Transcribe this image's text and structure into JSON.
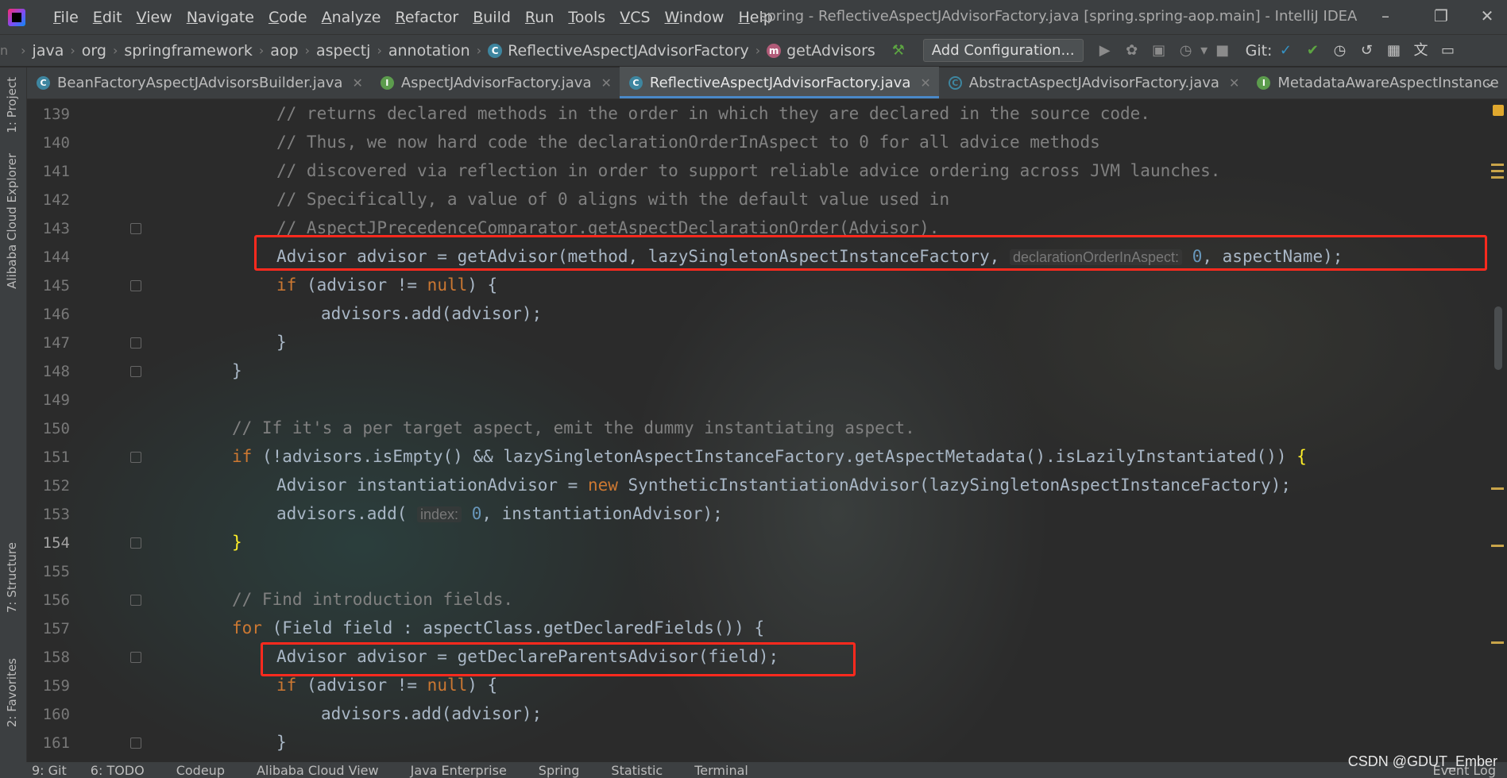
{
  "menu": [
    "File",
    "Edit",
    "View",
    "Navigate",
    "Code",
    "Analyze",
    "Refactor",
    "Build",
    "Run",
    "Tools",
    "VCS",
    "Window",
    "Help"
  ],
  "window_title": "spring - ReflectiveAspectJAdvisorFactory.java [spring.spring-aop.main] - IntelliJ IDEA",
  "breadcrumb": [
    "java",
    "org",
    "springframework",
    "aop",
    "aspectj",
    "annotation",
    "ReflectiveAspectJAdvisorFactory",
    "getAdvisors"
  ],
  "toolbar": {
    "add_configuration": "Add Configuration...",
    "git_label": "Git:"
  },
  "tabs": [
    {
      "label": "BeanFactoryAspectJAdvisorsBuilder.java",
      "icon": "class-icon"
    },
    {
      "label": "AspectJAdvisorFactory.java",
      "icon": "interface-icon"
    },
    {
      "label": "ReflectiveAspectJAdvisorFactory.java",
      "icon": "class-icon",
      "active": true
    },
    {
      "label": "AbstractAspectJAdvisorFactory.java",
      "icon": "abstract-class-icon"
    },
    {
      "label": "MetadataAwareAspectInstance",
      "icon": "interface-icon"
    }
  ],
  "left_tools": [
    "1: Project",
    "Alibaba Cloud Explorer",
    "7: Structure",
    "2: Favorites"
  ],
  "code": {
    "line_numbers": [
      "139",
      "140",
      "141",
      "142",
      "143",
      "144",
      "145",
      "146",
      "147",
      "148",
      "149",
      "150",
      "151",
      "152",
      "153",
      "154",
      "155",
      "156",
      "157",
      "158",
      "159",
      "160",
      "161"
    ],
    "current_line": "154",
    "l139": "// returns declared methods in the order in which they are declared in the source code.",
    "l140": "// Thus, we now hard code the declarationOrderInAspect to 0 for all advice methods",
    "l141": "// discovered via reflection in order to support reliable advice ordering across JVM launches.",
    "l142": "// Specifically, a value of 0 aligns with the default value used in",
    "l143": "// AspectJPrecedenceComparator.getAspectDeclarationOrder(Advisor).",
    "l144a": "Advisor advisor = getAdvisor(method, lazySingletonAspectInstanceFactory, ",
    "l144hint": "declarationOrderInAspect:",
    "l144b": "0",
    "l144c": ", aspectName);",
    "l145": "(advisor != ",
    "l146": "advisors.add(advisor);",
    "l147": "}",
    "l148": "}",
    "l150": "// If it's a per target aspect, emit the dummy instantiating aspect.",
    "l151": "(!advisors.isEmpty() && lazySingletonAspectInstanceFactory.getAspectMetadata().isLazilyInstantiated()) ",
    "l152a": "Advisor instantiationAdvisor = ",
    "l152b": "SyntheticInstantiationAdvisor(lazySingletonAspectInstanceFactory);",
    "l153a": "advisors.add( ",
    "l153hint": "index:",
    "l153b": "0",
    "l153c": ", instantiationAdvisor);",
    "l154": "}",
    "l156": "// Find introduction fields.",
    "l157": "(Field field : aspectClass.getDeclaredFields()) {",
    "l158": "Advisor advisor = getDeclareParentsAdvisor(field);",
    "l159": "(advisor != ",
    "l160": "advisors.add(advisor);",
    "l161": "}",
    "kw_if": "if",
    "kw_null": "null",
    "kw_new": "new",
    "kw_for": "for",
    "brace_open": "{",
    "paren_brace": ") {"
  },
  "bottom_tools": [
    "9: Git",
    "6: TODO",
    "Codeup",
    "Alibaba Cloud View",
    "Java Enterprise",
    "Spring",
    "Statistic",
    "Terminal",
    "Event Log"
  ],
  "watermark": "CSDN @GDUT_Ember"
}
